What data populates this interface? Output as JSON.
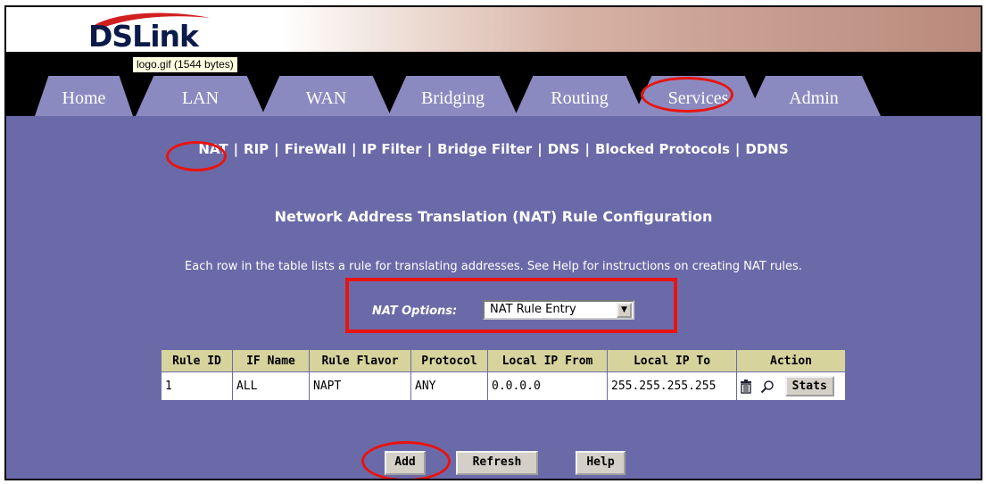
{
  "header": {
    "logo_text": "DSLink",
    "tooltip": "logo.gif (1544 bytes)"
  },
  "tabs": [
    {
      "label": "Home"
    },
    {
      "label": "LAN"
    },
    {
      "label": "WAN"
    },
    {
      "label": "Bridging"
    },
    {
      "label": "Routing"
    },
    {
      "label": "Services",
      "active": true
    },
    {
      "label": "Admin"
    }
  ],
  "subnav": {
    "items": [
      "NAT",
      "RIP",
      "FireWall",
      "IP Filter",
      "Bridge Filter",
      "DNS",
      "Blocked Protocols",
      "DDNS"
    ],
    "separator": "|"
  },
  "page": {
    "title": "Network Address Translation (NAT) Rule Configuration",
    "description": "Each row in the table lists a rule for translating addresses. See Help for instructions on creating NAT rules."
  },
  "options": {
    "label": "NAT Options:",
    "selected": "NAT Rule Entry"
  },
  "table": {
    "headers": [
      "Rule ID",
      "IF Name",
      "Rule Flavor",
      "Protocol",
      "Local IP From",
      "Local IP To",
      "Action"
    ],
    "rows": [
      {
        "rule_id": "1",
        "if_name": "ALL",
        "rule_flavor": "NAPT",
        "protocol": "ANY",
        "local_ip_from": "0.0.0.0",
        "local_ip_to": "255.255.255.255",
        "action_label": "Stats"
      }
    ]
  },
  "buttons": {
    "add": "Add",
    "refresh": "Refresh",
    "help": "Help"
  },
  "colors": {
    "background": "#6b6aa9",
    "tab": "#8b8ac0",
    "table_header": "#d6d39d",
    "highlight_ring": "#e8140e"
  }
}
